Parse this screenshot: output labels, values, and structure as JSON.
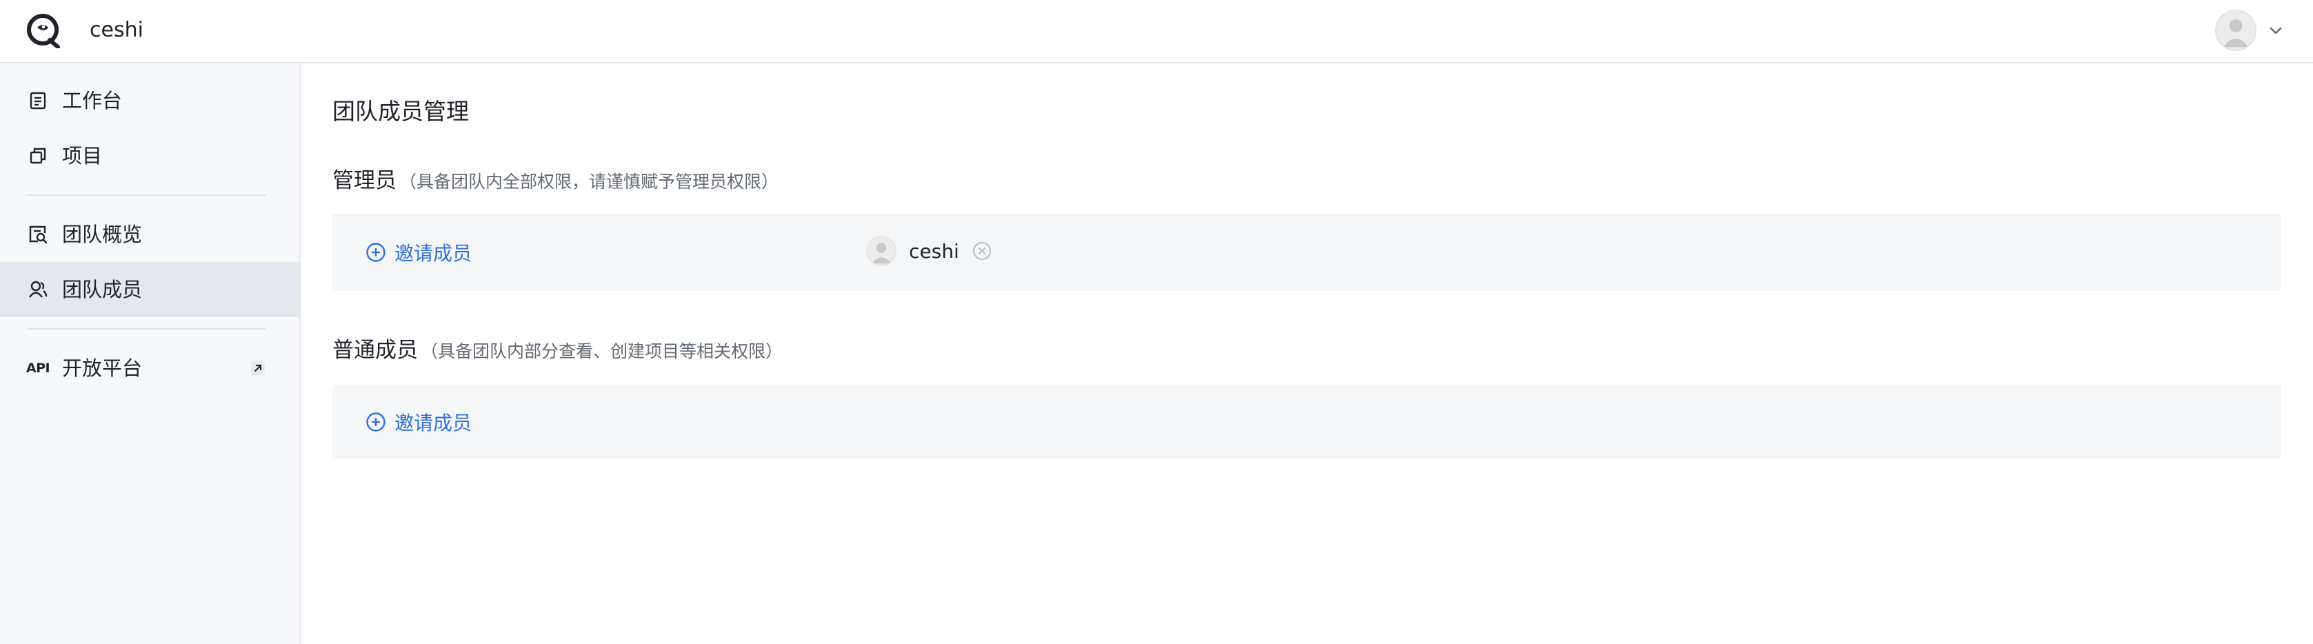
{
  "header": {
    "team_name": "ceshi"
  },
  "sidebar": {
    "items": [
      {
        "label": "工作台",
        "icon": "workbench-icon"
      },
      {
        "label": "项目",
        "icon": "project-icon"
      },
      {
        "label": "团队概览",
        "icon": "team-overview-icon"
      },
      {
        "label": "团队成员",
        "icon": "team-member-icon",
        "active": true
      },
      {
        "label": "开放平台",
        "icon": "api-icon",
        "icon_text": "API",
        "external": true
      }
    ]
  },
  "main": {
    "title": "团队成员管理",
    "admin_section": {
      "title": "管理员",
      "note": "（具备团队内全部权限，请谨慎赋予管理员权限）",
      "invite_label": "邀请成员",
      "members": [
        {
          "name": "ceshi"
        }
      ]
    },
    "member_section": {
      "title": "普通成员",
      "note": "（具备团队内部分查看、创建项目等相关权限）",
      "invite_label": "邀请成员"
    }
  },
  "colors": {
    "accent": "#2f6fdb",
    "active_nav_bg": "#e4e7ed",
    "sidebar_bg": "#f7f8fa",
    "panel_bg": "#f5f6f8"
  }
}
